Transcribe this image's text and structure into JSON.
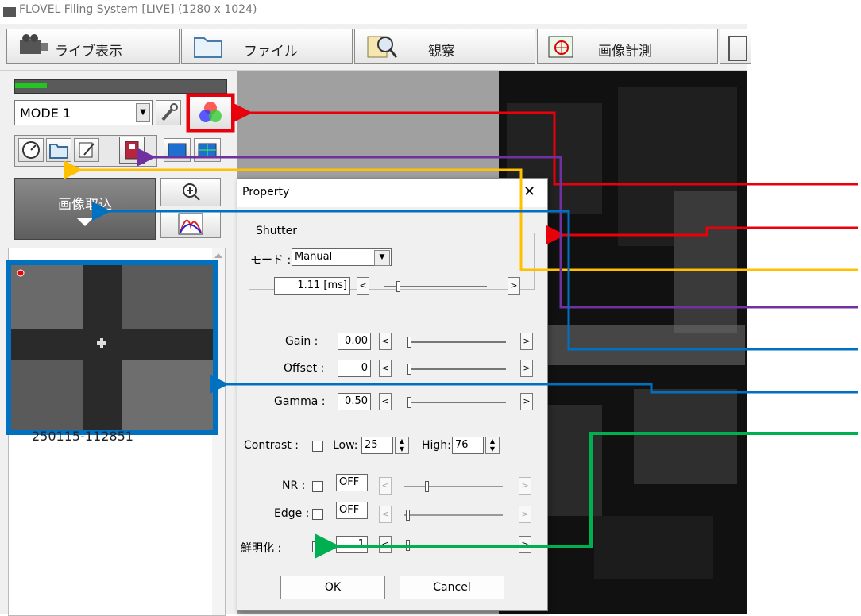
{
  "window": {
    "title": "FLOVEL Filing System [LIVE] (1280 x 1024)"
  },
  "toolbar": {
    "tabs": [
      "ライブ表示",
      "ファイル",
      "観察",
      "画像計測"
    ]
  },
  "left_panel": {
    "mode_value": "MODE 1",
    "capture_label": "画像取込",
    "thumbnail_label": "250115-112851"
  },
  "dialog": {
    "title": "Property",
    "close": "✕",
    "shutter": {
      "group_label": "Shutter",
      "mode_label": "モード :",
      "mode_value": "Manual",
      "value": "1.11 [ms]"
    },
    "gain": {
      "label": "Gain :",
      "value": "0.00"
    },
    "offset": {
      "label": "Offset :",
      "value": "0"
    },
    "gamma": {
      "label": "Gamma :",
      "value": "0.50"
    },
    "contrast": {
      "label": "Contrast :",
      "low_label": "Low:",
      "low_value": "25",
      "high_label": "High:",
      "high_value": "76"
    },
    "nr": {
      "label": "NR :",
      "value": "OFF"
    },
    "edge": {
      "label": "Edge :",
      "value": "OFF"
    },
    "sharpen": {
      "label": "鮮明化 :",
      "value": "1"
    },
    "ok": "OK",
    "cancel": "Cancel"
  },
  "colors": {
    "red": "#e8000b",
    "purple": "#7030a0",
    "orange": "#ffc000",
    "blue": "#0070c0",
    "green": "#00b050"
  }
}
